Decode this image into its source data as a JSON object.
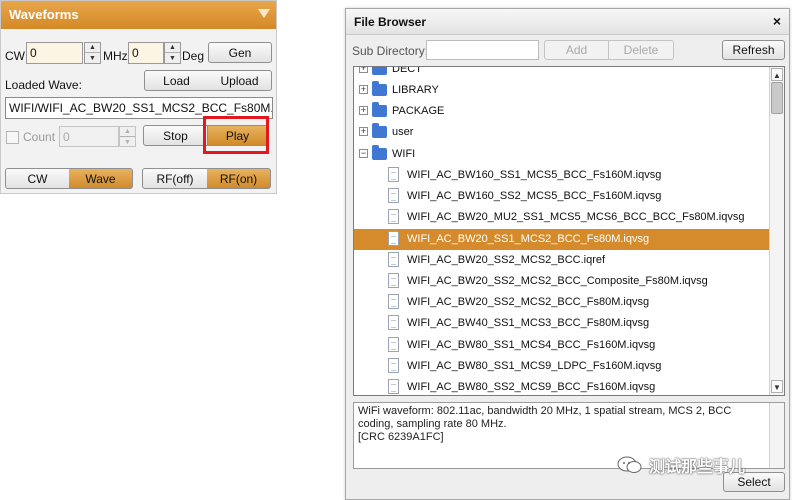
{
  "waveforms": {
    "title": "Waveforms",
    "cw_label": "CW",
    "cw_value": "0",
    "mhz_label": "MHz",
    "deg_value": "0",
    "deg_label": "Deg",
    "gen_label": "Gen",
    "loaded_wave_label": "Loaded Wave:",
    "load_label": "Load",
    "upload_label": "Upload",
    "loaded_wave_value": "WIFI/WIFI_AC_BW20_SS1_MCS2_BCC_Fs80M.",
    "count_label": "Count",
    "count_value": "0",
    "stop_label": "Stop",
    "play_label": "Play",
    "mode_cw_label": "CW",
    "mode_wave_label": "Wave",
    "rf_off_label": "RF(off)",
    "rf_on_label": "RF(on)",
    "accent_color": "#d48a26",
    "highlight_color": "#e3181e"
  },
  "file_browser": {
    "title": "File Browser",
    "close_label": "×",
    "subdir_label": "Sub Directory:",
    "subdir_value": "",
    "add_label": "Add",
    "delete_label": "Delete",
    "refresh_label": "Refresh",
    "folders": [
      {
        "label": "DECT",
        "expander": "+"
      },
      {
        "label": "LIBRARY",
        "expander": "+"
      },
      {
        "label": "PACKAGE",
        "expander": "+"
      },
      {
        "label": "user",
        "expander": "+"
      },
      {
        "label": "WIFI",
        "expander": "−"
      }
    ],
    "files": [
      "WIFI_AC_BW160_SS1_MCS5_BCC_Fs160M.iqvsg",
      "WIFI_AC_BW160_SS2_MCS5_BCC_Fs160M.iqvsg",
      "WIFI_AC_BW20_MU2_SS1_MCS5_MCS6_BCC_BCC_Fs80M.iqvsg",
      "WIFI_AC_BW20_SS1_MCS2_BCC_Fs80M.iqvsg",
      "WIFI_AC_BW20_SS2_MCS2_BCC.iqref",
      "WIFI_AC_BW20_SS2_MCS2_BCC_Composite_Fs80M.iqvsg",
      "WIFI_AC_BW20_SS2_MCS2_BCC_Fs80M.iqvsg",
      "WIFI_AC_BW40_SS1_MCS3_BCC_Fs80M.iqvsg",
      "WIFI_AC_BW80_SS1_MCS4_BCC_Fs160M.iqvsg",
      "WIFI_AC_BW80_SS1_MCS9_LDPC_Fs160M.iqvsg",
      "WIFI_AC_BW80_SS2_MCS9_BCC_Fs160M.iqvsg"
    ],
    "selected_file": "WIFI_AC_BW20_SS1_MCS2_BCC_Fs80M.iqvsg",
    "description_line1": "WiFi waveform: 802.11ac, bandwidth 20 MHz, 1 spatial stream, MCS 2, BCC coding, sampling rate 80 MHz.",
    "description_line2": "[CRC 6239A1FC]",
    "select_label": "Select",
    "selection_color": "#d58b2b",
    "folder_color": "#3f77d2"
  },
  "watermark": {
    "text": "测试那些事儿"
  }
}
